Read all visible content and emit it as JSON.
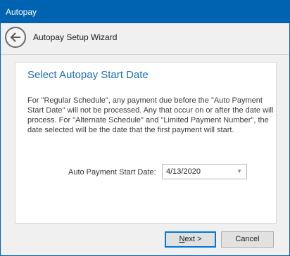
{
  "window": {
    "title": "Autopay"
  },
  "header": {
    "title": "Autopay Setup Wizard",
    "back_icon": "back-arrow-icon"
  },
  "step": {
    "title": "Select Autopay Start Date",
    "description": "For \"Regular Schedule\", any payment due before the \"Auto Payment Start Date\" will not be processed. Any that occur on or after the date will process. For \"Alternate Schedule\" and \"Limited Payment Number\", the date selected will be the date that the first payment will start.",
    "field_label": "Auto Payment Start Date:",
    "start_date_value": "4/13/2020"
  },
  "footer": {
    "next_mnemonic": "N",
    "next_rest": "ext >",
    "cancel_label": "Cancel"
  },
  "colors": {
    "titlebar": "#0063b1",
    "step_title": "#1c6fb8",
    "primary_border": "#0078d7"
  }
}
